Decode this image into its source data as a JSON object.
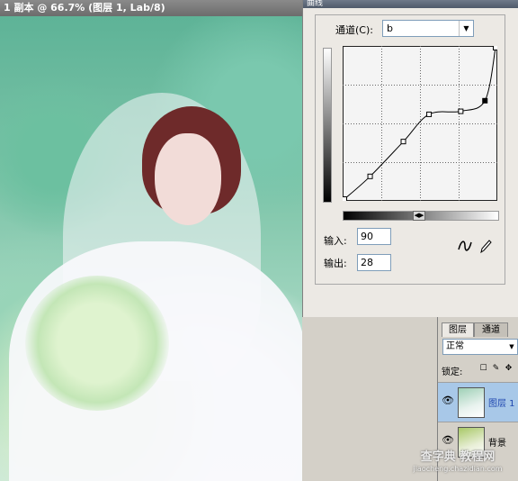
{
  "document": {
    "title": "1 副本 @ 66.7% (图层 1, Lab/8)"
  },
  "curves_dialog": {
    "title": "曲线",
    "channel_label": "通道(C):",
    "channel_value": "b",
    "input_label": "输入:",
    "input_value": "90",
    "output_label": "输出:",
    "output_value": "28",
    "tools": [
      "curve-point-icon",
      "pencil-icon"
    ],
    "slider_icon": "◀▶"
  },
  "curve": {
    "points": [
      [
        0,
        0
      ],
      [
        0.17,
        0.15
      ],
      [
        0.39,
        0.38
      ],
      [
        0.56,
        0.56
      ],
      [
        0.77,
        0.58
      ],
      [
        0.93,
        0.65
      ],
      [
        1,
        1
      ]
    ]
  },
  "layers_panel": {
    "tabs": [
      "图层",
      "通道"
    ],
    "blend_mode": "正常",
    "lock_label": "锁定:",
    "lock_icons": [
      "☐",
      "✎",
      "✥"
    ],
    "layers": [
      {
        "name": "图层 1",
        "active": true
      },
      {
        "name": "背景",
        "active": false
      }
    ]
  },
  "watermark": {
    "line1": "查字典 教程网",
    "line2": "jiaocheng.chazidian.com"
  },
  "colors": {
    "active_layer": "#a8c8e8",
    "titlebar": "#6c6c6c"
  }
}
